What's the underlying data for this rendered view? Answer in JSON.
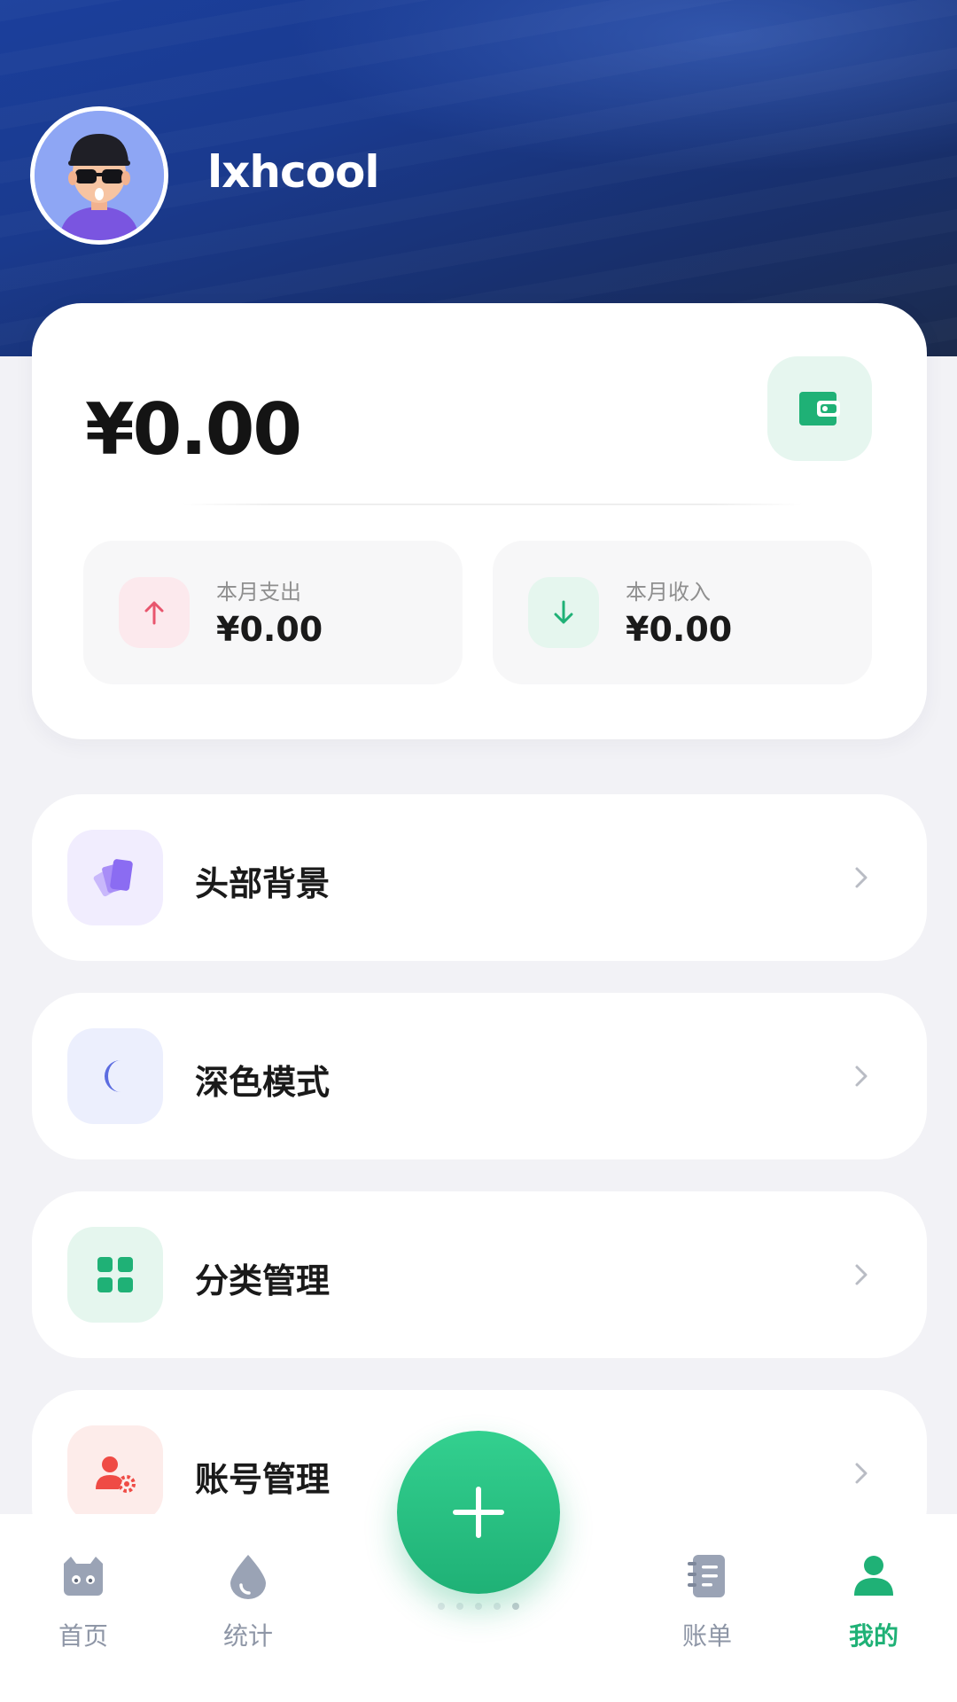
{
  "profile": {
    "username": "lxhcool",
    "avatar_icon": "cartoon-avatar-icon"
  },
  "balance": {
    "amount": "¥0.00",
    "wallet_icon": "wallet-icon"
  },
  "stats": {
    "expense": {
      "label": "本月支出",
      "value": "¥0.00",
      "icon": "arrow-up-icon",
      "color": "#e8556d",
      "bg": "#fce9ed"
    },
    "income": {
      "label": "本月收入",
      "value": "¥0.00",
      "icon": "arrow-down-icon",
      "color": "#1fb176",
      "bg": "#e5f6ee"
    }
  },
  "menu": [
    {
      "label": "头部背景",
      "icon": "palette-cards-icon",
      "color": "#8b6cf2",
      "bg": "#f1edfe"
    },
    {
      "label": "深色模式",
      "icon": "moon-icon",
      "color": "#5c6ce0",
      "bg": "#eceffd"
    },
    {
      "label": "分类管理",
      "icon": "grid-icon",
      "color": "#1fb176",
      "bg": "#e5f6ee"
    },
    {
      "label": "账号管理",
      "icon": "user-settings-icon",
      "color": "#ef4b45",
      "bg": "#fdecea"
    }
  ],
  "nav": {
    "items": [
      {
        "label": "首页",
        "icon": "home-cat-icon",
        "active": false
      },
      {
        "label": "统计",
        "icon": "drop-icon",
        "active": false
      },
      {
        "label": "账单",
        "icon": "notebook-icon",
        "active": false
      },
      {
        "label": "我的",
        "icon": "person-icon",
        "active": true
      }
    ],
    "add_icon": "plus-icon"
  },
  "colors": {
    "accent": "#1fb176",
    "header": "#1a3a8e",
    "background": "#f2f2f6",
    "inactive": "#8e96a6"
  }
}
